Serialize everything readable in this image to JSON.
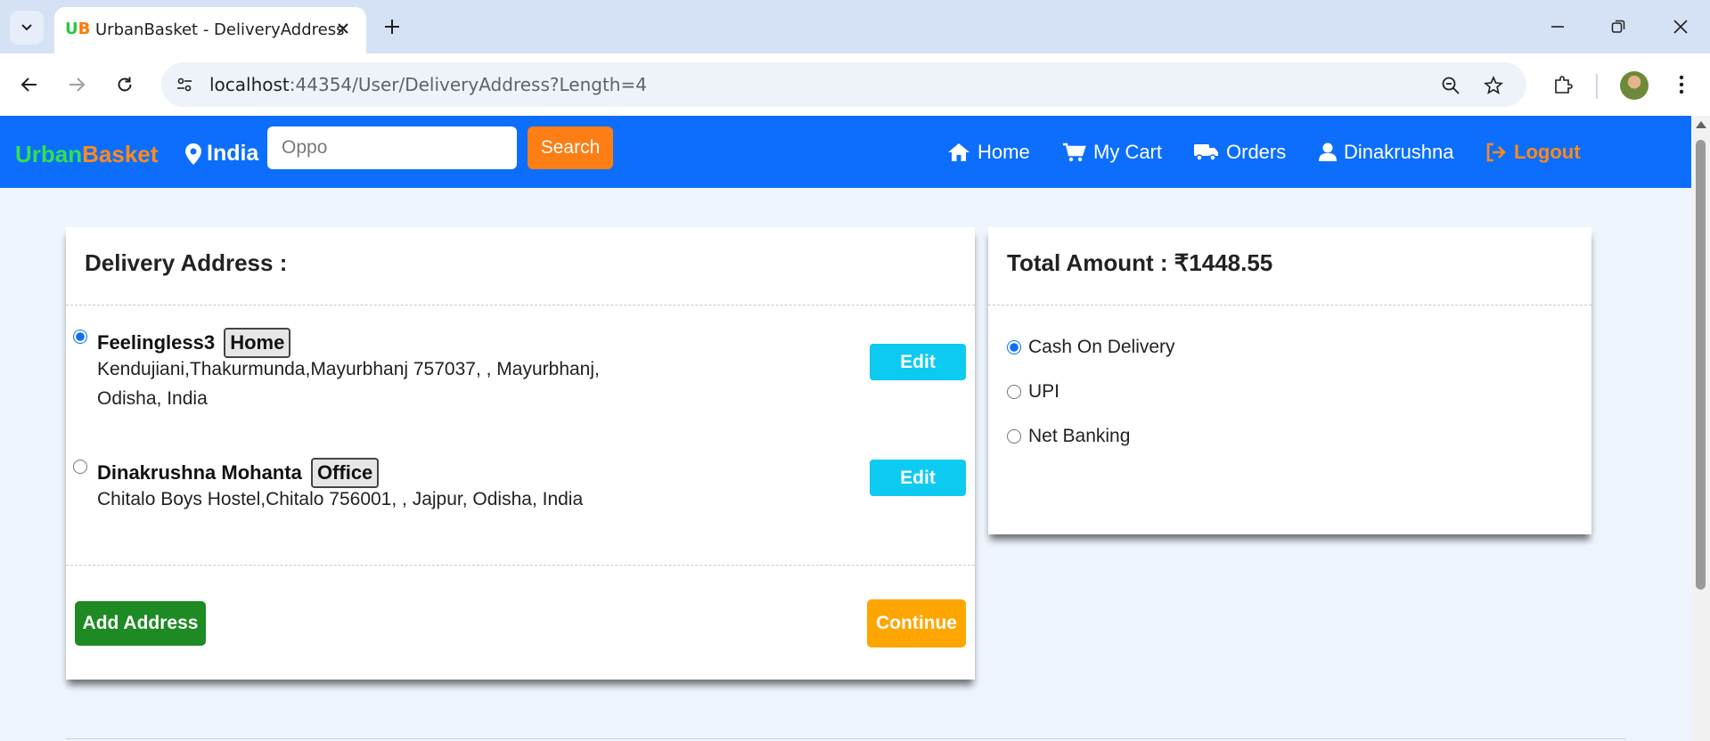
{
  "browser": {
    "tab_title": "UrbanBasket - DeliveryAddress",
    "favicon_text": "UB",
    "url_host": "localhost",
    "url_path": ":44354/User/DeliveryAddress?Length=4"
  },
  "navbar": {
    "brand_part1": "Urban",
    "brand_part2": "Basket",
    "location": "India",
    "search_value": "",
    "search_placeholder": "Oppo",
    "search_button": "Search",
    "links": {
      "home": "Home",
      "cart": "My Cart",
      "orders": "Orders",
      "user": "Dinakrushna",
      "logout": "Logout"
    }
  },
  "delivery": {
    "title": "Delivery Address :",
    "addresses": [
      {
        "name": "Feelingless3",
        "tag": "Home",
        "line1": "Kendujiani,Thakurmunda,Mayurbhanj 757037, , Mayurbhanj,",
        "line2": "Odisha, India",
        "selected": true,
        "edit_label": "Edit"
      },
      {
        "name": "Dinakrushna Mohanta",
        "tag": "Office",
        "line1": "Chitalo Boys Hostel,Chitalo 756001, , Jajpur, Odisha, India",
        "selected": false,
        "edit_label": "Edit"
      }
    ],
    "add_button": "Add Address",
    "continue_button": "Continue"
  },
  "payment": {
    "title": "Total Amount : ₹1448.55",
    "options": [
      {
        "label": "Cash On Delivery",
        "selected": true
      },
      {
        "label": "UPI",
        "selected": false
      },
      {
        "label": "Net Banking",
        "selected": false
      }
    ]
  },
  "colors": {
    "navbar": "#0d6efd",
    "search_button": "#fd7e14",
    "edit_button": "#0dcaf0",
    "add_button": "#1e8a23",
    "continue_button": "#ffa500"
  }
}
